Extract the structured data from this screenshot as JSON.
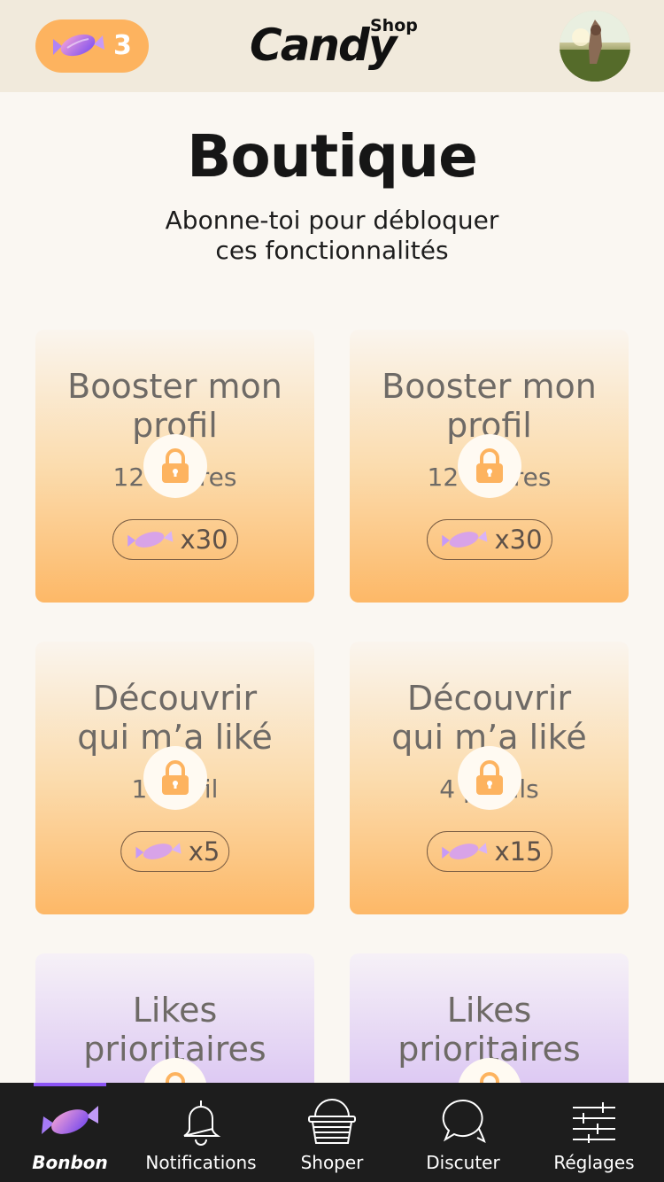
{
  "header": {
    "candy_count": "3",
    "logo_word": "Candy",
    "logo_sub": "Shop",
    "colors": {
      "pill": "#fdb35f",
      "header_bg": "#f1eadc"
    }
  },
  "page": {
    "title": "Boutique",
    "subtitle_line1": "Abonne-toi pour débloquer",
    "subtitle_line2": "ces fonctionnalités"
  },
  "cards": [
    {
      "title_line1": "Booster mon",
      "title_line2": "profil",
      "detail": "12 heures",
      "price": "x30",
      "style": "orange"
    },
    {
      "title_line1": "Booster mon",
      "title_line2": "profil",
      "detail": "12 heures",
      "price": "x30",
      "style": "orange"
    },
    {
      "title_line1": "Découvrir",
      "title_line2": "qui m’a liké",
      "detail": "1 profil",
      "price": "x5",
      "style": "orange"
    },
    {
      "title_line1": "Découvrir",
      "title_line2": "qui m’a liké",
      "detail": "4 profils",
      "price": "x15",
      "style": "orange"
    },
    {
      "title_line1": "Likes",
      "title_line2": "prioritaires",
      "detail": "",
      "price": "",
      "style": "purple"
    },
    {
      "title_line1": "Likes",
      "title_line2": "prioritaires",
      "detail": "",
      "price": "",
      "style": "purple"
    }
  ],
  "nav": {
    "items": [
      {
        "label": "Bonbon",
        "icon": "candy-icon",
        "active": true
      },
      {
        "label": "Notifications",
        "icon": "bell-icon",
        "active": false
      },
      {
        "label": "Shoper",
        "icon": "basket-icon",
        "active": false
      },
      {
        "label": "Discuter",
        "icon": "chat-bubbles-icon",
        "active": false
      },
      {
        "label": "Réglages",
        "icon": "sliders-icon",
        "active": false
      }
    ],
    "active_color": "#8b54f5"
  }
}
